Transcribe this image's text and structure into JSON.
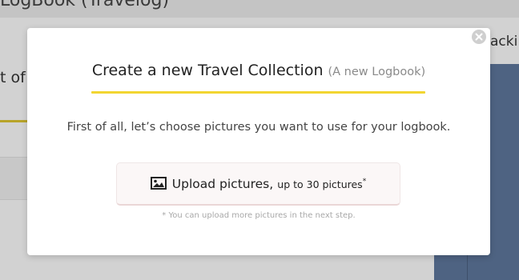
{
  "background": {
    "title": "LogBook (Travelog)",
    "left_text": "t of",
    "right_text": "acki"
  },
  "modal": {
    "title": "Create a new Travel Collection",
    "subtitle": "(A new Logbook)",
    "instruction": "First of all, let’s choose pictures you want to use for your logbook.",
    "upload_button": {
      "icon": "image-icon",
      "label": "Upload pictures,",
      "limit": "up to 30 pictures",
      "asterisk": "*"
    },
    "footnote": "* You can upload more pictures in the next step.",
    "close_icon": "close-icon"
  },
  "colors": {
    "accent_underline": "#f2d531",
    "overlay": "#d2d2d2",
    "modal_background": "#ffffff"
  }
}
